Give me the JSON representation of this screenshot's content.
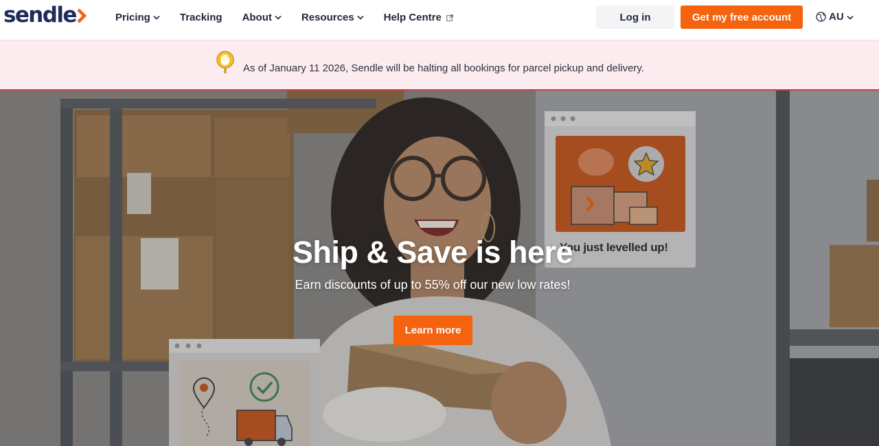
{
  "header": {
    "logo_text": "sendle",
    "nav": [
      {
        "label": "Pricing",
        "has_dropdown": true
      },
      {
        "label": "Tracking",
        "has_dropdown": false
      },
      {
        "label": "About",
        "has_dropdown": true
      },
      {
        "label": "Resources",
        "has_dropdown": true
      },
      {
        "label": "Help Centre",
        "external": true
      }
    ],
    "login_label": "Log in",
    "cta_label": "Get my free account",
    "region_label": "AU"
  },
  "banner": {
    "icon": "hand-stop-icon",
    "text": "As of January 11 2026, Sendle will be halting all bookings for parcel pickup and delivery."
  },
  "hero": {
    "title": "Ship & Save is here",
    "subtitle": "Earn discounts of up to 55% off our new low rates!",
    "button_label": "Learn more",
    "card_text": "You just levelled up!"
  },
  "colors": {
    "brand_orange": "#f5630f",
    "brand_navy": "#1f2b5b",
    "banner_bg": "#fdecef",
    "banner_border": "#d43a45"
  }
}
